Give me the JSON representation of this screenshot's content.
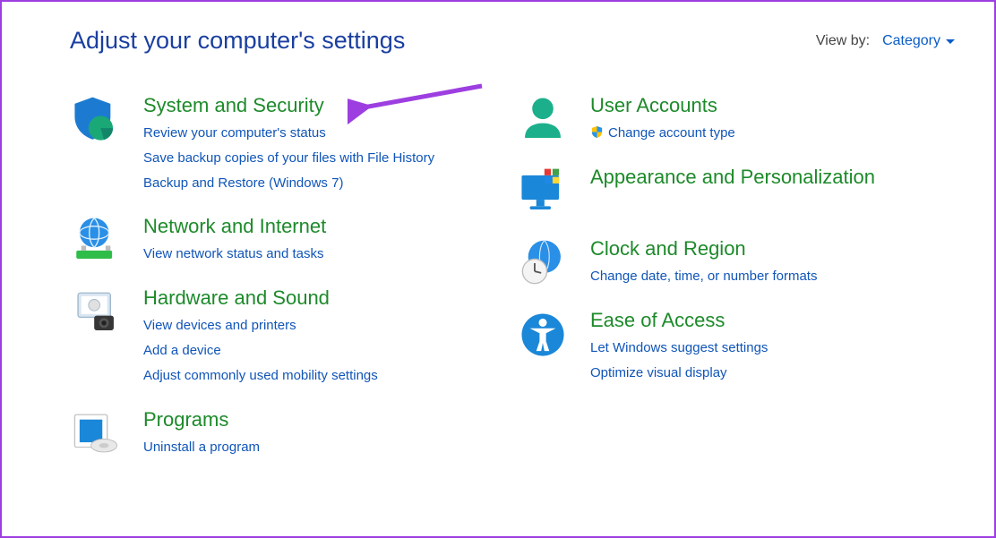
{
  "header": {
    "title": "Adjust your computer's settings",
    "viewby_label": "View by:",
    "viewby_value": "Category"
  },
  "left": [
    {
      "id": "system-security",
      "title": "System and Security",
      "links": [
        "Review your computer's status",
        "Save backup copies of your files with File History",
        "Backup and Restore (Windows 7)"
      ]
    },
    {
      "id": "network-internet",
      "title": "Network and Internet",
      "links": [
        "View network status and tasks"
      ]
    },
    {
      "id": "hardware-sound",
      "title": "Hardware and Sound",
      "links": [
        "View devices and printers",
        "Add a device",
        "Adjust commonly used mobility settings"
      ]
    },
    {
      "id": "programs",
      "title": "Programs",
      "links": [
        "Uninstall a program"
      ]
    }
  ],
  "right": [
    {
      "id": "user-accounts",
      "title": "User Accounts",
      "links": [
        "Change account type"
      ],
      "shield": [
        true
      ]
    },
    {
      "id": "appearance-personalization",
      "title": "Appearance and Personalization",
      "links": []
    },
    {
      "id": "clock-region",
      "title": "Clock and Region",
      "links": [
        "Change date, time, or number formats"
      ]
    },
    {
      "id": "ease-of-access",
      "title": "Ease of Access",
      "links": [
        "Let Windows suggest settings",
        "Optimize visual display"
      ]
    }
  ]
}
